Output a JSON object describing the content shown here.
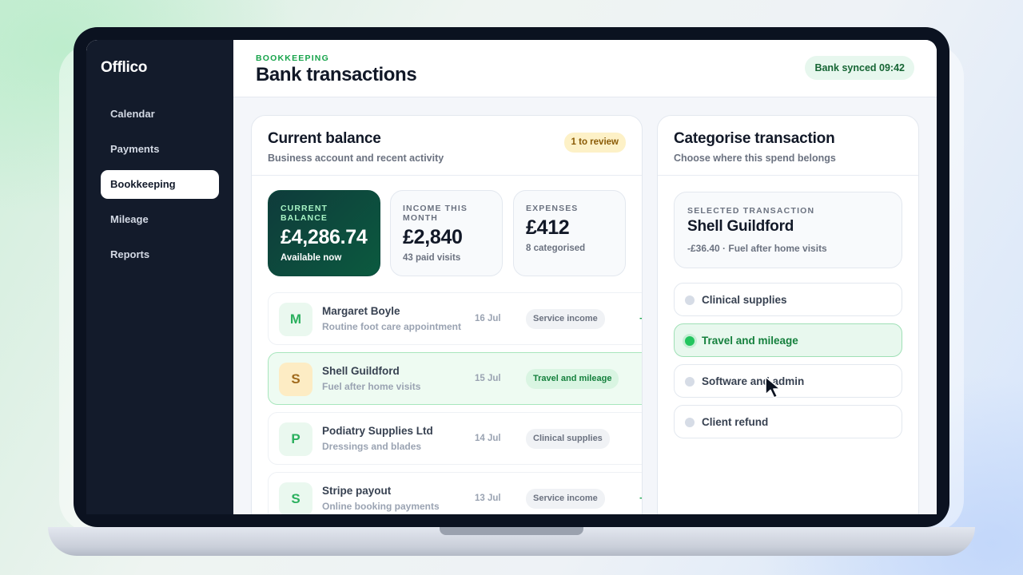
{
  "app": {
    "brand": "Offlico"
  },
  "sidebar": {
    "items": [
      {
        "label": "Calendar",
        "active": false
      },
      {
        "label": "Payments",
        "active": false
      },
      {
        "label": "Bookkeeping",
        "active": true
      },
      {
        "label": "Mileage",
        "active": false
      },
      {
        "label": "Reports",
        "active": false
      }
    ]
  },
  "header": {
    "eyebrow": "BOOKKEEPING",
    "title": "Bank transactions",
    "sync_status": "Bank synced 09:42"
  },
  "balance_card": {
    "title": "Current balance",
    "subtitle": "Business account and recent activity",
    "review_badge": "1 to review",
    "stats": [
      {
        "label": "CURRENT BALANCE",
        "value": "£4,286.74",
        "foot": "Available now"
      },
      {
        "label": "INCOME THIS MONTH",
        "value": "£2,840",
        "foot": "43 paid visits"
      },
      {
        "label": "EXPENSES",
        "value": "£412",
        "foot": "8 categorised"
      }
    ],
    "transactions": [
      {
        "initial": "M",
        "name": "Margaret Boyle",
        "description": "Routine foot care appointment",
        "date": "16 Jul",
        "category": "Service income",
        "amount": "+"
      },
      {
        "initial": "S",
        "name": "Shell Guildford",
        "description": "Fuel after home visits",
        "date": "15 Jul",
        "category": "Travel and mileage",
        "selected": true
      },
      {
        "initial": "P",
        "name": "Podiatry Supplies Ltd",
        "description": "Dressings and blades",
        "date": "14 Jul",
        "category": "Clinical supplies"
      },
      {
        "initial": "S",
        "name": "Stripe payout",
        "description": "Online booking payments",
        "date": "13 Jul",
        "category": "Service income",
        "amount": "+"
      }
    ]
  },
  "categorise_card": {
    "title": "Categorise transaction",
    "subtitle": "Choose where this spend belongs",
    "selected": {
      "label": "SELECTED TRANSACTION",
      "name": "Shell Guildford",
      "detail": "-£36.40 · Fuel after home visits"
    },
    "options": [
      {
        "label": "Clinical supplies",
        "active": false
      },
      {
        "label": "Travel and mileage",
        "active": true
      },
      {
        "label": "Software and admin",
        "active": false
      },
      {
        "label": "Client refund",
        "active": false
      }
    ]
  },
  "colors": {
    "accent_green": "#16a34a",
    "sidebar_bg": "#131b2b",
    "balance_tile_bg": "#0b5a3f",
    "review_badge_bg": "#fdf1c7"
  },
  "icons": {
    "cursor": "mouse-pointer-icon"
  }
}
